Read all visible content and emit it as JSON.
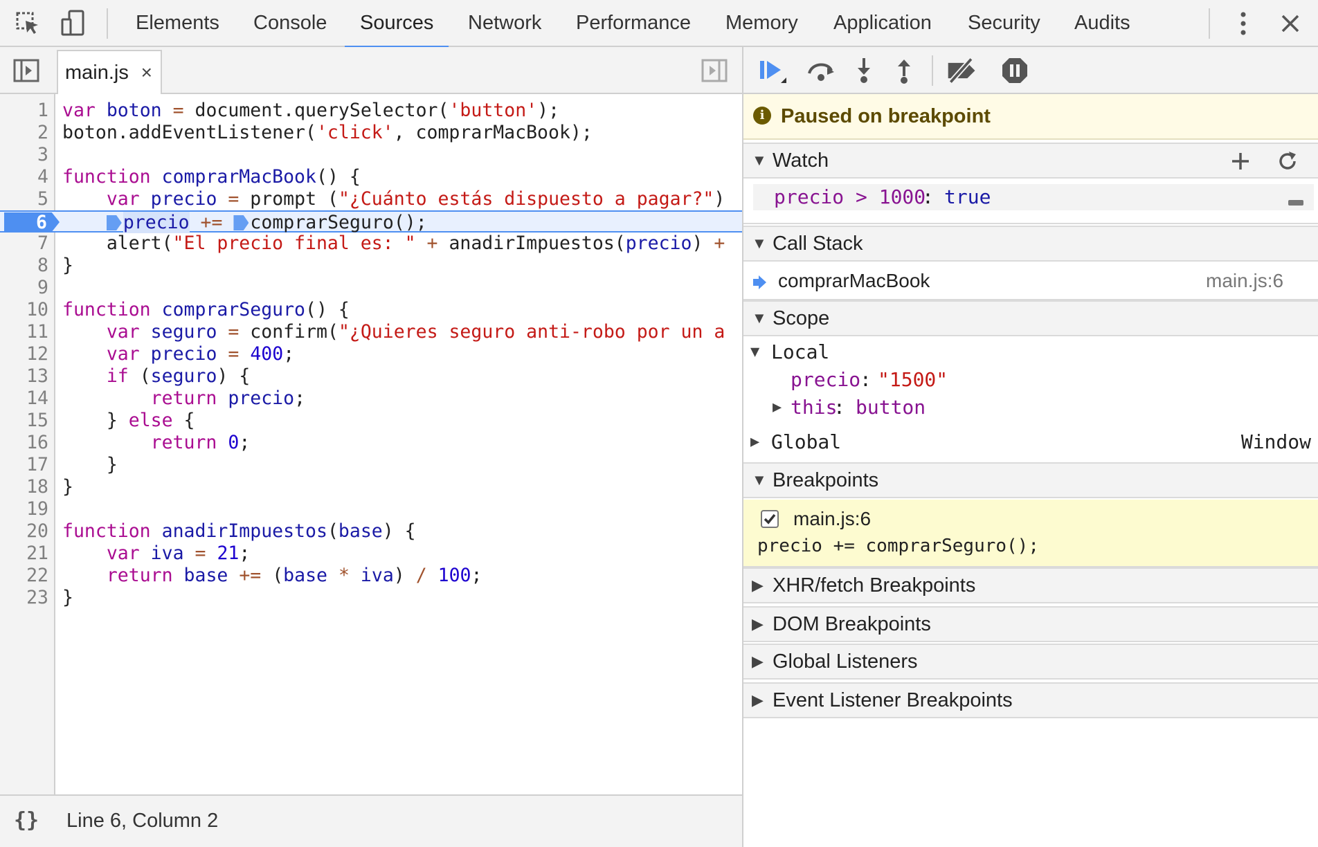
{
  "toolbar": {
    "inspect_icon": "inspect-element-icon",
    "device_icon": "device-toolbar-icon",
    "tabs": [
      "Elements",
      "Console",
      "Sources",
      "Network",
      "Performance",
      "Memory",
      "Application",
      "Security",
      "Audits"
    ],
    "active_tab": "Sources",
    "more_icon": "kebab-menu-icon",
    "close_icon": "close-icon"
  },
  "editor": {
    "file_tab": "main.js",
    "file_tab_close": "×",
    "status": "Line 6, Column 2",
    "pretty_print": "{}",
    "breakpoint_line": 6,
    "line_numbers": [
      "1",
      "2",
      "3",
      "4",
      "5",
      "6",
      "7",
      "8",
      "9",
      "10",
      "11",
      "12",
      "13",
      "14",
      "15",
      "16",
      "17",
      "18",
      "19",
      "20",
      "21",
      "22",
      "23"
    ]
  },
  "debugger": {
    "paused_text": "Paused on breakpoint",
    "watch": {
      "title": "Watch",
      "expression": "precio > 1000",
      "sep": ": ",
      "value": "true"
    },
    "call_stack": {
      "title": "Call Stack",
      "frame": "comprarMacBook",
      "location": "main.js:6"
    },
    "scope": {
      "title": "Scope",
      "local_label": "Local",
      "precio_key": "precio",
      "precio_value": "\"1500\"",
      "this_key": "this",
      "this_value": "button",
      "global_label": "Global",
      "global_value": "Window"
    },
    "breakpoints": {
      "title": "Breakpoints",
      "file": "main.js:6",
      "code": "precio += comprarSeguro();",
      "checked": true
    },
    "collapsed_sections": [
      "XHR/fetch Breakpoints",
      "DOM Breakpoints",
      "Global Listeners",
      "Event Listener Breakpoints"
    ]
  },
  "colors": {
    "accent": "#4e8ff1",
    "paused_bg": "#fffbe6",
    "breakpoint_bg": "#fdfbd0",
    "keyword": "#aa0d91",
    "string": "#c41a16",
    "number": "#1c00cf"
  }
}
